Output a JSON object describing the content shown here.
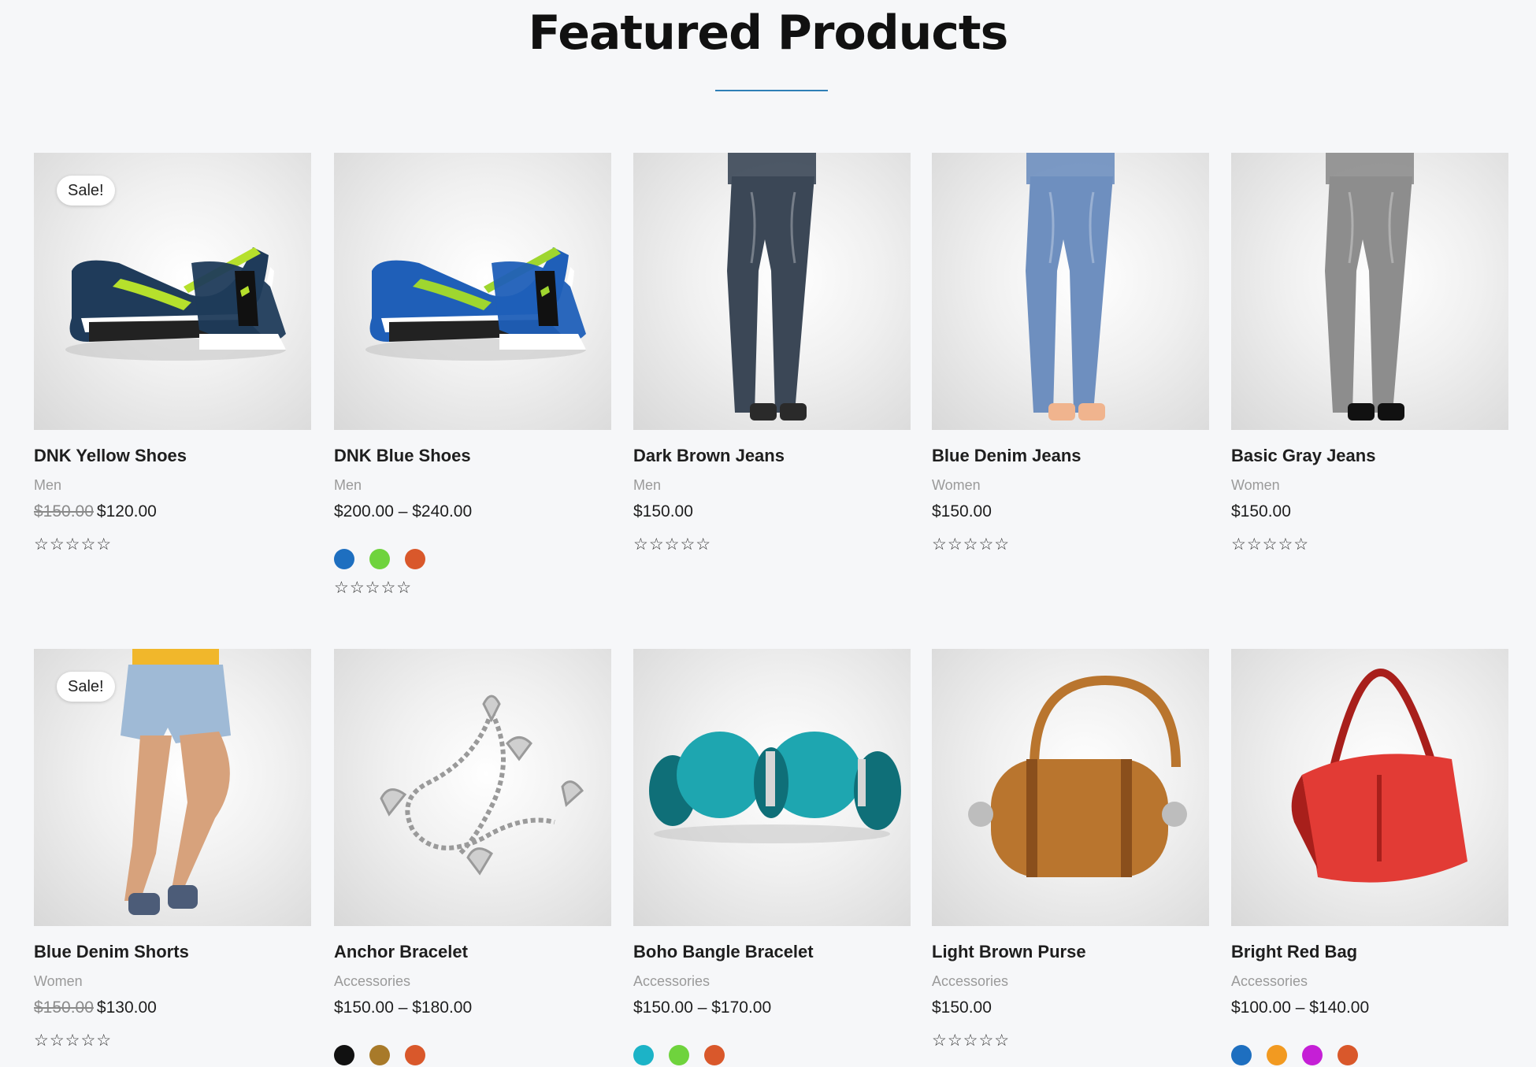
{
  "page": {
    "title": "Featured Products",
    "accent": "#2f7fb6"
  },
  "products": [
    {
      "name": "DNK Yellow Shoes",
      "category": "Men",
      "old_price": "$150.00",
      "price": "$120.00",
      "sale_label": "Sale!",
      "rating_text": "☆☆☆☆☆",
      "swatches": [],
      "image_icon": "sneaker-icon",
      "image_color": "#1f3b5a",
      "image_accent": "#b6e02c"
    },
    {
      "name": "DNK Blue Shoes",
      "category": "Men",
      "old_price": "",
      "price": "$200.00 – $240.00",
      "sale_label": "",
      "rating_text": "☆☆☆☆☆",
      "swatches": [
        "#1e6fc0",
        "#6fd33d",
        "#d9582b"
      ],
      "image_icon": "sneaker-icon",
      "image_color": "#1f5fb8",
      "image_accent": "#9fd62f"
    },
    {
      "name": "Dark Brown Jeans",
      "category": "Men",
      "old_price": "",
      "price": "$150.00",
      "sale_label": "",
      "rating_text": "☆☆☆☆☆",
      "swatches": [],
      "image_icon": "jeans-icon",
      "image_color": "#3b4756",
      "image_accent": "#2a2a2a"
    },
    {
      "name": "Blue Denim Jeans",
      "category": "Women",
      "old_price": "",
      "price": "$150.00",
      "sale_label": "",
      "rating_text": "☆☆☆☆☆",
      "swatches": [],
      "image_icon": "jeans-icon",
      "image_color": "#6e8fbf",
      "image_accent": "#f0b48e"
    },
    {
      "name": "Basic Gray Jeans",
      "category": "Women",
      "old_price": "",
      "price": "$150.00",
      "sale_label": "",
      "rating_text": "☆☆☆☆☆",
      "swatches": [],
      "image_icon": "jeans-icon",
      "image_color": "#8d8d8d",
      "image_accent": "#111111"
    },
    {
      "name": "Blue Denim Shorts",
      "category": "Women",
      "old_price": "$150.00",
      "price": "$130.00",
      "sale_label": "Sale!",
      "rating_text": "☆☆☆☆☆",
      "swatches": [],
      "image_icon": "shorts-icon",
      "image_color": "#9fbad6",
      "image_accent": "#d7a27c"
    },
    {
      "name": "Anchor Bracelet",
      "category": "Accessories",
      "old_price": "",
      "price": "$150.00 – $180.00",
      "sale_label": "",
      "rating_text": "",
      "swatches": [
        "#111111",
        "#a87a2a",
        "#d9582b"
      ],
      "image_icon": "chain-bracelet-icon",
      "image_color": "#9a9a9a",
      "image_accent": "#cfcfcf"
    },
    {
      "name": "Boho Bangle Bracelet",
      "category": "Accessories",
      "old_price": "",
      "price": "$150.00 – $170.00",
      "sale_label": "",
      "rating_text": "",
      "swatches": [
        "#1cb3c7",
        "#6fd33d",
        "#d9582b"
      ],
      "image_icon": "bangle-icon",
      "image_color": "#1ea6b0",
      "image_accent": "#0f6f78"
    },
    {
      "name": "Light Brown Purse",
      "category": "Accessories",
      "old_price": "",
      "price": "$150.00",
      "sale_label": "",
      "rating_text": "☆☆☆☆☆",
      "swatches": [],
      "image_icon": "purse-icon",
      "image_color": "#b9752e",
      "image_accent": "#8a4f1c"
    },
    {
      "name": "Bright Red Bag",
      "category": "Accessories",
      "old_price": "",
      "price": "$100.00 – $140.00",
      "sale_label": "",
      "rating_text": "",
      "swatches": [
        "#1e6fc0",
        "#f29a21",
        "#c51fd6",
        "#d9582b"
      ],
      "image_icon": "handbag-icon",
      "image_color": "#e23b35",
      "image_accent": "#a81f1b"
    }
  ]
}
